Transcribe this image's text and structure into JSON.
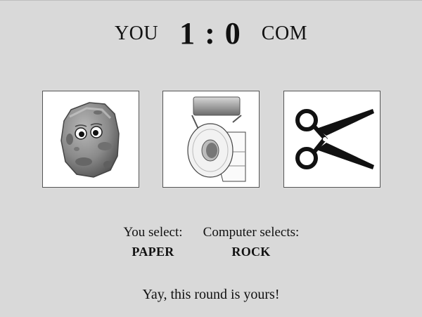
{
  "scoreboard": {
    "player_label": "YOU",
    "computer_label": "COM",
    "player_score": "1",
    "separator": ":",
    "computer_score": "0"
  },
  "choices": [
    {
      "name": "rock",
      "icon": "rock-icon"
    },
    {
      "name": "paper",
      "icon": "toilet-paper-icon"
    },
    {
      "name": "scissors",
      "icon": "scissors-icon"
    }
  ],
  "selection": {
    "you_label": "You select:",
    "you_value": "PAPER",
    "computer_label": "Computer selects:",
    "computer_value": "ROCK"
  },
  "result_message": "Yay, this round is yours!",
  "colors": {
    "background": "#d9d9d9",
    "card": "#ffffff",
    "card_border": "#555555"
  }
}
